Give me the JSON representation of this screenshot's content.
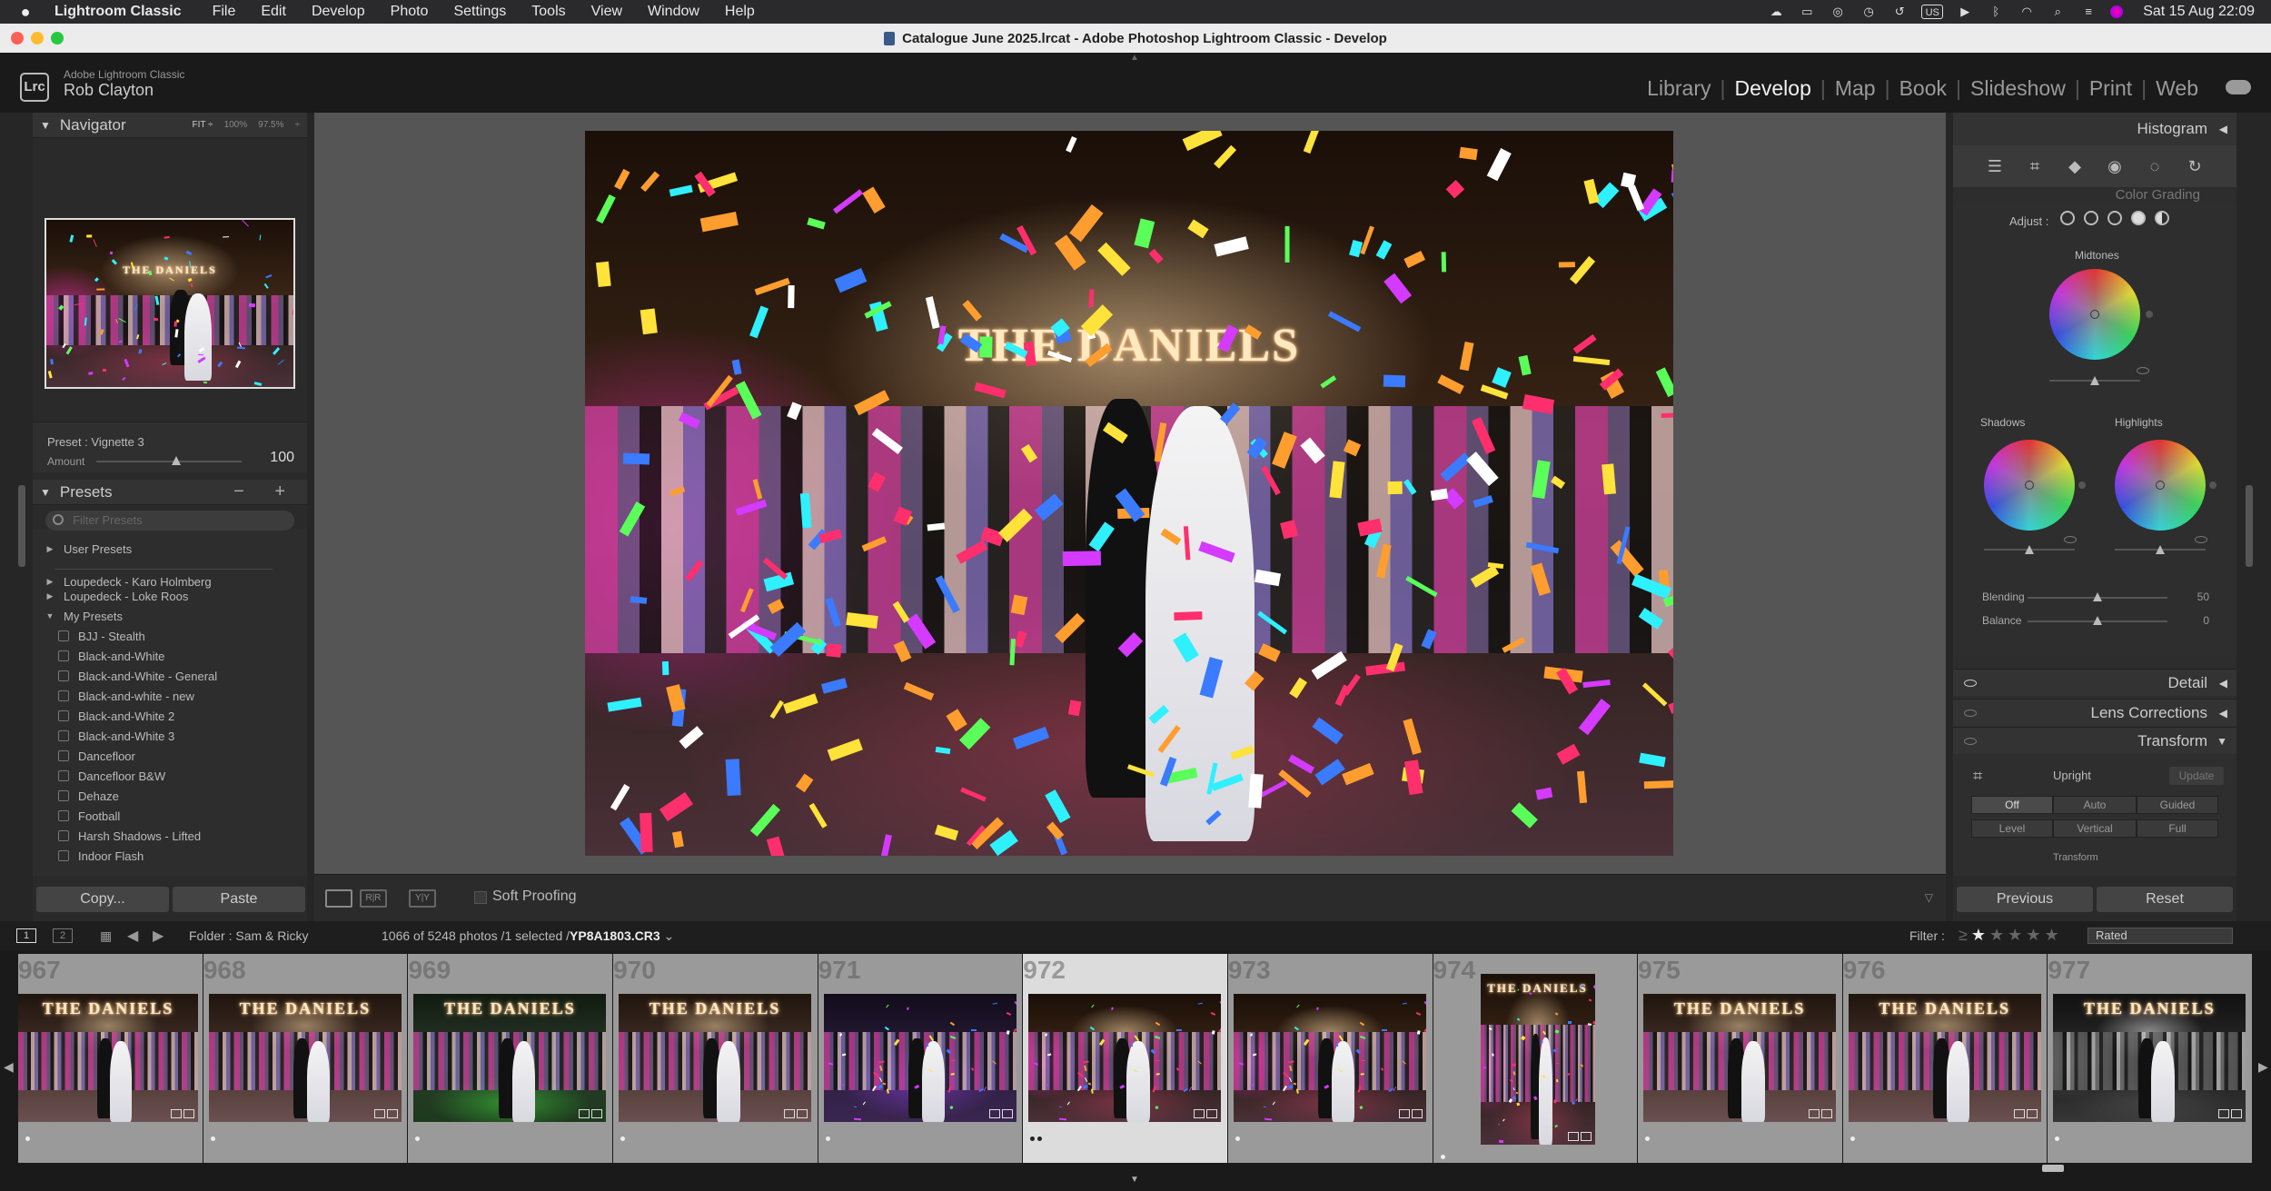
{
  "menubar": {
    "app": "Lightroom Classic",
    "items": [
      "File",
      "Edit",
      "Develop",
      "Photo",
      "Settings",
      "Tools",
      "View",
      "Window",
      "Help"
    ],
    "input_source": "US",
    "clock": "Sat 15 Aug  22:09"
  },
  "window": {
    "title": "Catalogue June 2025.lrcat - Adobe Photoshop Lightroom Classic - Develop"
  },
  "identity": {
    "product": "Adobe Lightroom Classic",
    "user": "Rob Clayton",
    "logo": "Lrc",
    "modules": [
      "Library",
      "Develop",
      "Map",
      "Book",
      "Slideshow",
      "Print",
      "Web"
    ],
    "active_module": "Develop"
  },
  "navigator": {
    "title": "Navigator",
    "zoom_options": [
      "FIT ÷",
      "100%",
      "97.5%",
      "÷"
    ],
    "photo_sign": "THE DANIELS"
  },
  "preset_amount": {
    "preset": "Preset : Vignette 3",
    "label": "Amount",
    "value": "100",
    "fraction": 0.55
  },
  "presets": {
    "title": "Presets",
    "controls": "− +",
    "search_placeholder": "Filter Presets",
    "items": [
      {
        "label": "User Presets",
        "type": "group",
        "state": "collapsed"
      },
      {
        "label": "Loupedeck - Karo Holmberg",
        "type": "group",
        "state": "collapsed"
      },
      {
        "label": "Loupedeck - Loke Roos",
        "type": "group",
        "state": "collapsed"
      },
      {
        "label": "My Presets",
        "type": "group",
        "state": "expanded"
      },
      {
        "label": "BJJ - Stealth",
        "type": "preset"
      },
      {
        "label": "Black-and-White",
        "type": "preset"
      },
      {
        "label": "Black-and-White - General",
        "type": "preset"
      },
      {
        "label": "Black-and-white - new",
        "type": "preset"
      },
      {
        "label": "Black-and-White 2",
        "type": "preset"
      },
      {
        "label": "Black-and-White 3",
        "type": "preset"
      },
      {
        "label": "Dancefloor",
        "type": "preset"
      },
      {
        "label": "Dancefloor B&W",
        "type": "preset"
      },
      {
        "label": "Dehaze",
        "type": "preset"
      },
      {
        "label": "Football",
        "type": "preset"
      },
      {
        "label": "Harsh Shadows - Lifted",
        "type": "preset"
      },
      {
        "label": "Indoor Flash",
        "type": "preset"
      }
    ]
  },
  "left_buttons": {
    "copy": "Copy...",
    "paste": "Paste"
  },
  "main_photo": {
    "sign": "THE DANIELS"
  },
  "toolbar": {
    "soft_proofing": "Soft Proofing",
    "view_compare": "Y|Y",
    "view_before_after": "R|R"
  },
  "right": {
    "histogram": "Histogram",
    "color_grading": {
      "ghost_title": "Color Grading",
      "adjust_label": "Adjust :",
      "midtones": "Midtones",
      "shadows": "Shadows",
      "highlights": "Highlights",
      "blending_label": "Blending",
      "blending_value": "50",
      "balance_label": "Balance",
      "balance_value": "0"
    },
    "sections": [
      "Detail",
      "Lens Corrections",
      "Transform"
    ],
    "transform": {
      "upright_label": "Upright",
      "update": "Update",
      "row1": [
        "Off",
        "Auto",
        "Guided"
      ],
      "row2": [
        "Level",
        "Vertical",
        "Full"
      ],
      "active": "Off",
      "sub_label": "Transform"
    },
    "buttons": {
      "previous": "Previous",
      "reset": "Reset"
    }
  },
  "filmstrip_header": {
    "pages": [
      "1",
      "2"
    ],
    "folder": "Folder : Sam & Ricky",
    "counts_prefix": "1066 of 5248 photos /1 selected /",
    "filename": "YP8A1803.CR3",
    "filename_suffix": " ⌄",
    "filter_label": "Filter :",
    "filter_op": "≥",
    "stars": 1,
    "filter_value": "Rated"
  },
  "filmstrip": {
    "selected": "972",
    "frames": [
      {
        "num": "967",
        "sign": "THE DANIELS",
        "style": "calm"
      },
      {
        "num": "968",
        "sign": "THE DANIELS",
        "style": "calm"
      },
      {
        "num": "969",
        "sign": "THE DANIELS",
        "style": "green"
      },
      {
        "num": "970",
        "sign": "THE DANIELS",
        "style": "calm"
      },
      {
        "num": "971",
        "sign": "",
        "style": "purple"
      },
      {
        "num": "972",
        "sign": "",
        "style": "main"
      },
      {
        "num": "973",
        "sign": "",
        "style": "main"
      },
      {
        "num": "974",
        "sign": "THE DANIELS",
        "style": "main",
        "portrait": true
      },
      {
        "num": "975",
        "sign": "THE DANIELS",
        "style": "calm"
      },
      {
        "num": "976",
        "sign": "THE DANIELS",
        "style": "calm"
      },
      {
        "num": "977",
        "sign": "THE DANIELS",
        "style": "bw"
      }
    ]
  }
}
